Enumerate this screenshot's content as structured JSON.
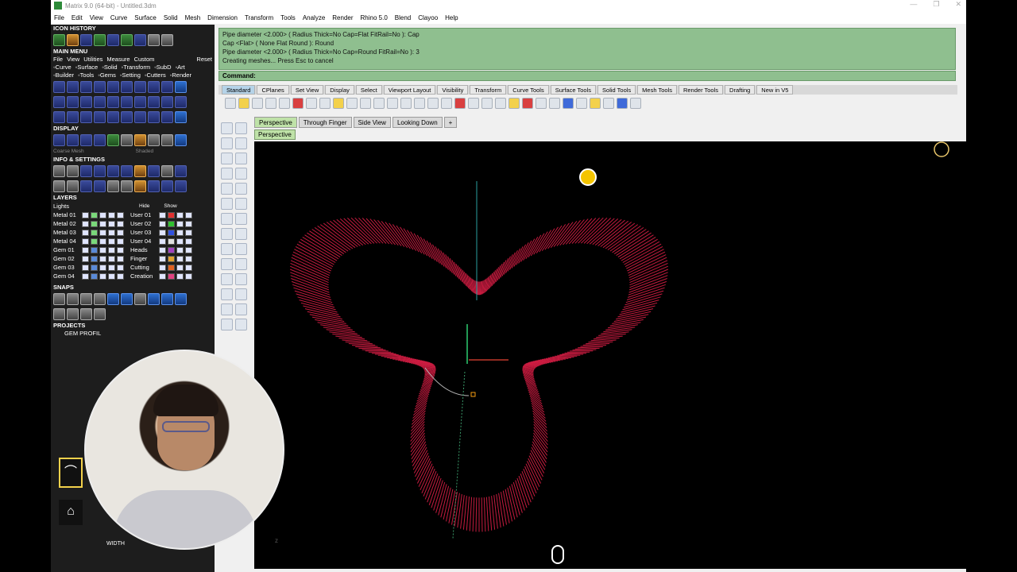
{
  "window": {
    "title": "Matrix 9.0 (64-bit) - Untitled.3dm",
    "controls": [
      "—",
      "❐",
      "✕"
    ]
  },
  "menubar": [
    "File",
    "Edit",
    "View",
    "Curve",
    "Surface",
    "Solid",
    "Mesh",
    "Dimension",
    "Transform",
    "Tools",
    "Analyze",
    "Render",
    "Rhino 5.0",
    "Blend",
    "Clayoo",
    "Help"
  ],
  "leftpanel": {
    "icon_history": "ICON HISTORY",
    "main_menu": "MAIN MENU",
    "main_menu_items": [
      "File",
      "View",
      "Utilities",
      "Measure",
      "Custom"
    ],
    "reset": "Reset",
    "row2": [
      "◦Curve",
      "◦Surface",
      "◦Solid",
      "◦Transform",
      "◦SubD",
      "◦Art"
    ],
    "row3": [
      "◦Builder",
      "◦Tools",
      "◦Gems",
      "◦Setting",
      "◦Cutters",
      "◦Render"
    ],
    "display": "DISPLAY",
    "display_sub": [
      "Coarse Mesh",
      "Shaded"
    ],
    "info": "INFO & SETTINGS",
    "layers": "LAYERS",
    "layer_header": [
      "Lights",
      "Hide",
      "Show"
    ],
    "layers_left": [
      "Metal 01",
      "Metal 02",
      "Metal 03",
      "Metal 04",
      "Gem 01",
      "Gem 02",
      "Gem 03",
      "Gem 04"
    ],
    "layers_right": [
      "User 01",
      "User 02",
      "User 03",
      "User 04",
      "Heads",
      "Finger",
      "Cutting",
      "Creation"
    ],
    "snaps": "SNAPS",
    "projects": "PROJECTS",
    "gem_profile": "GEM PROFIL",
    "width_label": "WIDTH"
  },
  "command": {
    "history": [
      "Pipe diameter <2.000> ( Radius  Thick=No  Cap=Flat  FitRail=No ): Cap",
      "Cap <Flat> ( None  Flat  Round ): Round",
      "Pipe diameter <2.000> ( Radius  Thick=No  Cap=Round  FitRail=No ): 3",
      "Creating meshes... Press Esc to cancel"
    ],
    "label": "Command:",
    "value": ""
  },
  "tabs": [
    "Standard",
    "CPlanes",
    "Set View",
    "Display",
    "Select",
    "Viewport Layout",
    "Visibility",
    "Transform",
    "Curve Tools",
    "Surface Tools",
    "Solid Tools",
    "Mesh Tools",
    "Render Tools",
    "Drafting",
    "New in V5"
  ],
  "viewport_tabs": [
    "Perspective",
    "Through Finger",
    "Side View",
    "Looking Down"
  ],
  "viewport_label": "Perspective",
  "colors": {
    "accent_command_bg": "#8fbf8f",
    "ribbon_color": "#e8204a",
    "active_tab": "#bfe2a8"
  }
}
